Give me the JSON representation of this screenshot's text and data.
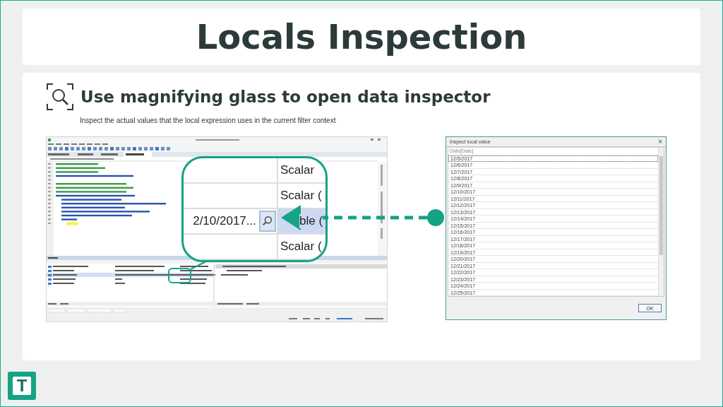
{
  "title": "Locals Inspection",
  "section": {
    "heading": "Use magnifying glass to open data inspector",
    "description": "Inspect the actual values that the local expression uses in the current filter context"
  },
  "zoom": {
    "rows": [
      {
        "left": "",
        "right": "Scalar",
        "selected": false
      },
      {
        "left": "",
        "right": "Scalar (",
        "selected": false
      },
      {
        "left": "2/10/2017...",
        "right": "ble (",
        "selected": true
      },
      {
        "left": "",
        "right": "Scalar (",
        "selected": false
      }
    ]
  },
  "dialog": {
    "title": "Inspect local value",
    "close": "×",
    "column": "Date[Date]",
    "rows": [
      {
        "text": "12/5/2017",
        "selected": true
      },
      {
        "text": "12/6/2017",
        "selected": false
      },
      {
        "text": "12/7/2017",
        "selected": false
      },
      {
        "text": "12/8/2017",
        "selected": false
      },
      {
        "text": "12/9/2017",
        "selected": false
      },
      {
        "text": "12/10/2017",
        "selected": false
      },
      {
        "text": "12/11/2017",
        "selected": false
      },
      {
        "text": "12/12/2017",
        "selected": false
      },
      {
        "text": "12/13/2017",
        "selected": false
      },
      {
        "text": "12/14/2017",
        "selected": false
      },
      {
        "text": "12/15/2017",
        "selected": false
      },
      {
        "text": "12/16/2017",
        "selected": false
      },
      {
        "text": "12/17/2017",
        "selected": false
      },
      {
        "text": "12/18/2017",
        "selected": false
      },
      {
        "text": "12/19/2017",
        "selected": false
      },
      {
        "text": "12/20/2017",
        "selected": false
      },
      {
        "text": "12/21/2017",
        "selected": false
      },
      {
        "text": "12/22/2017",
        "selected": false
      },
      {
        "text": "12/23/2017",
        "selected": false
      },
      {
        "text": "12/24/2017",
        "selected": false
      },
      {
        "text": "12/25/2017",
        "selected": false
      }
    ],
    "button": "OK"
  },
  "logo_letter": "T"
}
